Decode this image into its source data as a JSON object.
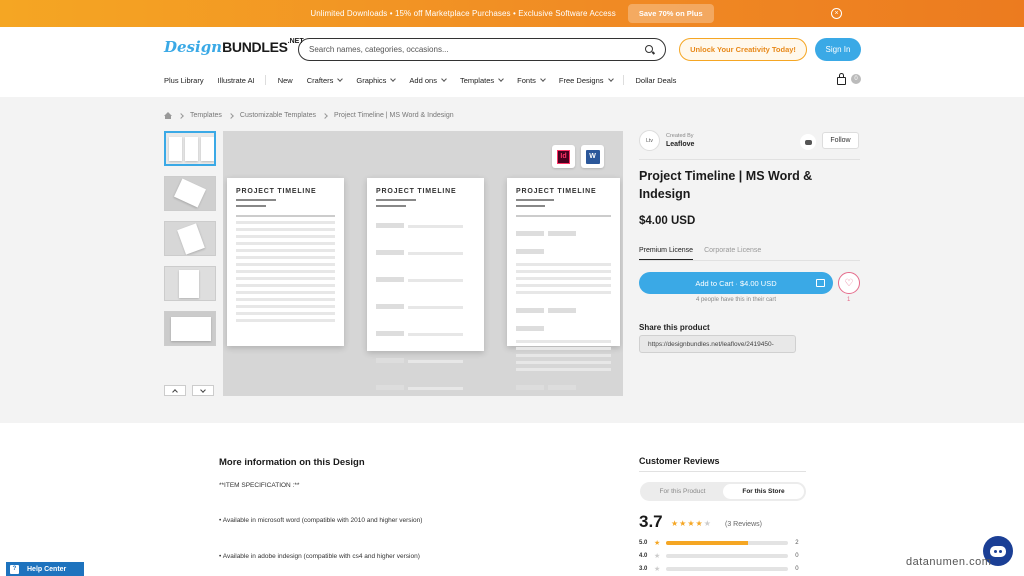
{
  "promo": {
    "text": "Unlimited Downloads  •  15% off Marketplace Purchases  •  Exclusive Software Access",
    "button": "Save 70% on Plus",
    "close": "×"
  },
  "header": {
    "logo_design": "Design",
    "logo_bundles": "BUNDLES",
    "logo_net": ".NET",
    "search_placeholder": "Search names, categories, occasions...",
    "unlock_label": "Unlock Your Creativity Today!",
    "signin_label": "Sign In",
    "cart_count": "0"
  },
  "nav": [
    {
      "label": "Plus Library",
      "chevron": false
    },
    {
      "label": "Illustrate AI",
      "chevron": false
    },
    {
      "label": "New",
      "chevron": false
    },
    {
      "label": "Crafters",
      "chevron": true
    },
    {
      "label": "Graphics",
      "chevron": true
    },
    {
      "label": "Add ons",
      "chevron": true
    },
    {
      "label": "Templates",
      "chevron": true
    },
    {
      "label": "Fonts",
      "chevron": true
    },
    {
      "label": "Free Designs",
      "chevron": true
    },
    {
      "label": "Dollar Deals",
      "chevron": false
    }
  ],
  "breadcrumb": [
    "Templates",
    "Customizable Templates",
    "Project Timeline | MS Word & Indesign"
  ],
  "preview": {
    "page_title": "PROJECT TIMELINE",
    "badge_id": "Id",
    "badge_word": "W"
  },
  "product": {
    "created_by": "Created By",
    "creator": "Leaflove",
    "avatar": "Ltv",
    "follow": "Follow",
    "title": "Project Timeline | MS Word & Indesign",
    "price": "$4.00 USD",
    "license_tabs": [
      "Premium License",
      "Corporate License"
    ],
    "add_to_cart": "Add to Cart · $4.00 USD",
    "cart_note": "4 people have this in their cart",
    "likes": "1",
    "share_title": "Share this product",
    "share_url": "https://designbundles.net/leaflove/2419450-"
  },
  "info": {
    "title": "More information on this Design",
    "lines": [
      "**ITEM SPECIFICATION :**",
      "• Available in microsoft word (compatible with 2010 and higher version)",
      "• Available in adobe indesign (compatible with cs4 and higher version)"
    ]
  },
  "reviews": {
    "title": "Customer Reviews",
    "tabs": [
      "For this Product",
      "For this Store"
    ],
    "rating": "3.7",
    "stars_filled": 4,
    "count_label": "(3 Reviews)",
    "bars": [
      {
        "label": "5.0",
        "value": 0.67,
        "count": "2"
      },
      {
        "label": "4.0",
        "value": 0,
        "count": "0"
      },
      {
        "label": "3.0",
        "value": 0,
        "count": "0"
      }
    ]
  },
  "help": {
    "label": "Help Center",
    "q": "?"
  },
  "watermark": "datanumen.com",
  "colors": {
    "accent": "#3aa9e6",
    "promo": "#f08a24",
    "star": "#f5a623"
  }
}
